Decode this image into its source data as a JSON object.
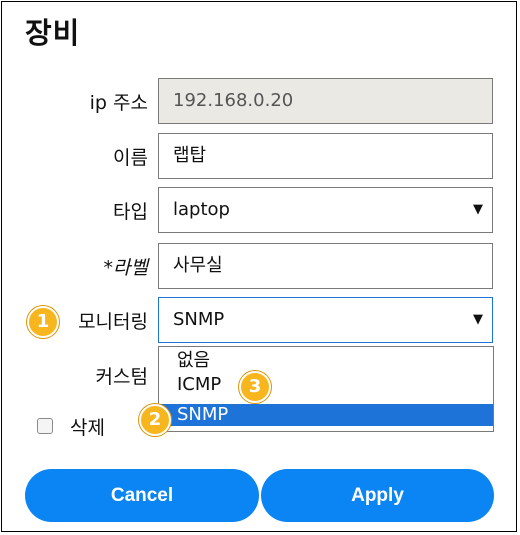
{
  "dialog": {
    "title": "장비"
  },
  "fields": {
    "ip": {
      "label": "ip 주소",
      "value": "192.168.0.20"
    },
    "name": {
      "label": "이름",
      "value": "랩탑"
    },
    "type": {
      "label": "타입",
      "value": "laptop"
    },
    "tag": {
      "label": "*라벨",
      "value": "사무실"
    },
    "monitoring": {
      "label": "모니터링",
      "value": "SNMP"
    },
    "custom": {
      "label": "커스텀"
    }
  },
  "dropdown": {
    "options": [
      "없음",
      "ICMP",
      "SNMP"
    ],
    "highlighted": "SNMP"
  },
  "delete": {
    "label": "삭제",
    "checked": false
  },
  "buttons": {
    "cancel": "Cancel",
    "apply": "Apply"
  },
  "badges": [
    "1",
    "2",
    "3"
  ],
  "colors": {
    "accent": "#0b85f3",
    "highlight": "#1e73d8",
    "badge": "#f7b61e"
  },
  "icons": {
    "select_caret": "caret-down-icon"
  }
}
